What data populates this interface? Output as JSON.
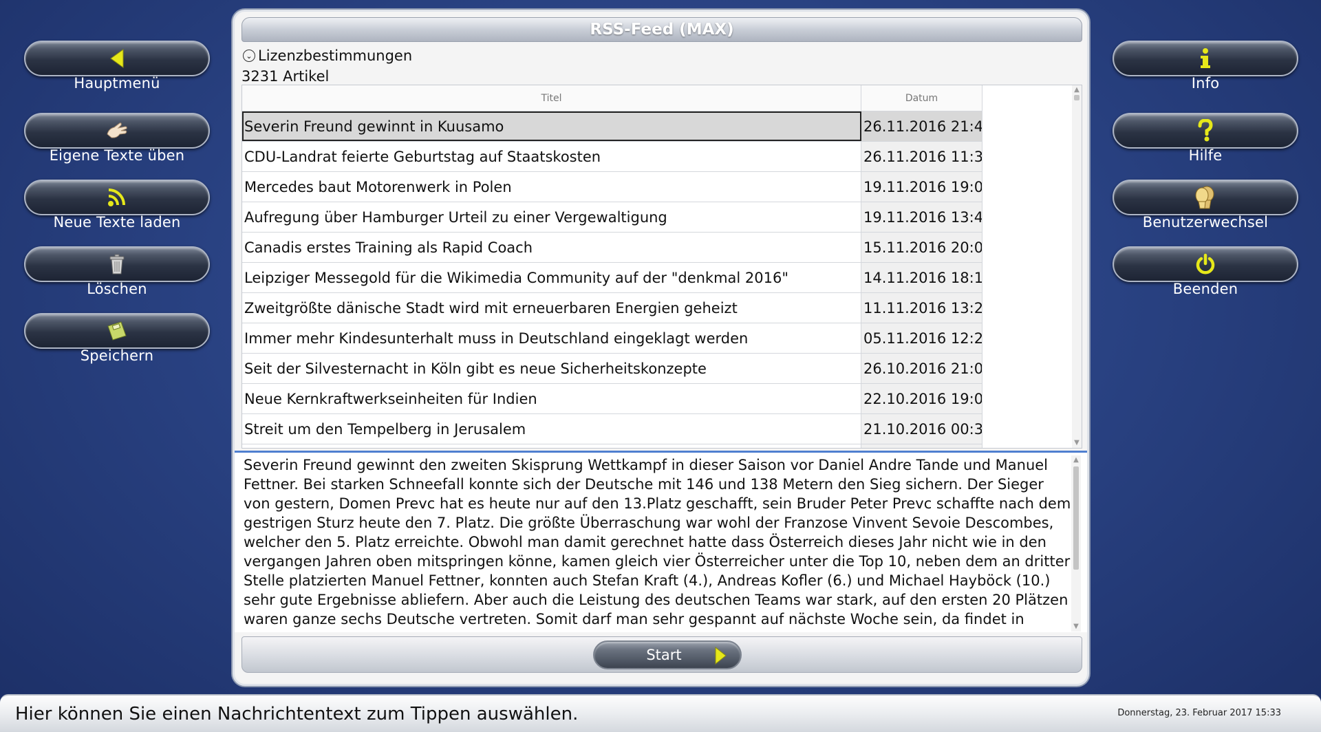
{
  "left_nav": [
    {
      "label": "Hauptmenü",
      "icon": "back-arrow-icon"
    },
    {
      "label": "Eigene Texte üben",
      "icon": "hand-icon"
    },
    {
      "label": "Neue Texte laden",
      "icon": "rss-icon"
    },
    {
      "label": "Löschen",
      "icon": "trash-icon"
    },
    {
      "label": "Speichern",
      "icon": "floppy-disk-icon"
    }
  ],
  "right_nav": [
    {
      "label": "Info",
      "icon": "info-icon"
    },
    {
      "label": "Hilfe",
      "icon": "help-icon"
    },
    {
      "label": "Benutzerwechsel",
      "icon": "user-switch-icon"
    },
    {
      "label": "Beenden",
      "icon": "power-icon"
    }
  ],
  "panel": {
    "title": "RSS-Feed (MAX)",
    "license_label": "Lizenzbestimmungen",
    "article_count": "3231 Artikel"
  },
  "table": {
    "headers": {
      "title": "Titel",
      "date": "Datum"
    },
    "rows": [
      {
        "title": "Severin Freund gewinnt in Kuusamo",
        "date": "26.11.2016 21:4",
        "selected": true
      },
      {
        "title": "CDU-Landrat feierte Geburtstag auf Staatskosten",
        "date": "26.11.2016 11:3"
      },
      {
        "title": "Mercedes baut Motorenwerk in Polen",
        "date": "19.11.2016 19:0"
      },
      {
        "title": "Aufregung über Hamburger Urteil zu einer Vergewaltigung",
        "date": "19.11.2016 13:4"
      },
      {
        "title": "Canadis erstes Training als Rapid Coach",
        "date": "15.11.2016 20:0"
      },
      {
        "title": "Leipziger Messegold für die Wikimedia Community auf der \"denkmal 2016\"",
        "date": "14.11.2016 18:1"
      },
      {
        "title": "Zweitgrößte dänische Stadt wird mit erneuerbaren Energien geheizt",
        "date": "11.11.2016 13:2"
      },
      {
        "title": "Immer mehr Kindesunterhalt muss in Deutschland eingeklagt werden",
        "date": "05.11.2016 12:2"
      },
      {
        "title": "Seit der Silvesternacht in Köln gibt es neue Sicherheitskonzepte",
        "date": "26.10.2016 21:0"
      },
      {
        "title": "Neue Kernkraftwerkseinheiten für Indien",
        "date": "22.10.2016 19:0"
      },
      {
        "title": "Streit um den Tempelberg in Jerusalem",
        "date": "21.10.2016 00:3"
      },
      {
        "title": "",
        "date": ""
      }
    ]
  },
  "article_text": "Severin Freund gewinnt den zweiten Skisprung Wettkampf in dieser Saison vor Daniel Andre Tande und Manuel Fettner. Bei starken Schneefall konnte sich der Deutsche mit 146 und 138 Metern den Sieg sichern. Der Sieger von gestern, Domen Prevc hat es heute nur auf den 13.Platz geschafft, sein Bruder Peter Prevc schaffte nach dem gestrigen Sturz heute den 7. Platz. Die größte Überraschung war wohl der Franzose Vinvent Sevoie Descombes, welcher den 5. Platz erreichte. Obwohl man damit gerechnet hatte dass Österreich dieses Jahr nicht wie in den vergangen Jahren oben mitspringen könne, kamen gleich vier Österreicher unter die Top 10, neben dem an dritter Stelle platzierten Manuel Fettner, konnten auch Stefan Kraft (4.), Andreas Kofler (6.) und Michael Hayböck (10.) sehr gute Ergebnisse abliefern. Aber auch die Leistung des deutschen Teams war stark, auf den ersten 20 Plätzen waren ganze sechs Deutsche vertreten. Somit darf man sehr gespannt auf nächste Woche sein, da findet in",
  "start_label": "Start",
  "status": {
    "message": "Hier können Sie einen Nachrichtentext zum Tippen auswählen.",
    "datetime": "Donnerstag, 23. Februar 2017 15:33"
  },
  "colors": {
    "background": "#2a4384",
    "accent_yellow": "#e6e81a",
    "selection_border": "#222222",
    "article_border": "#4f7fd0"
  }
}
